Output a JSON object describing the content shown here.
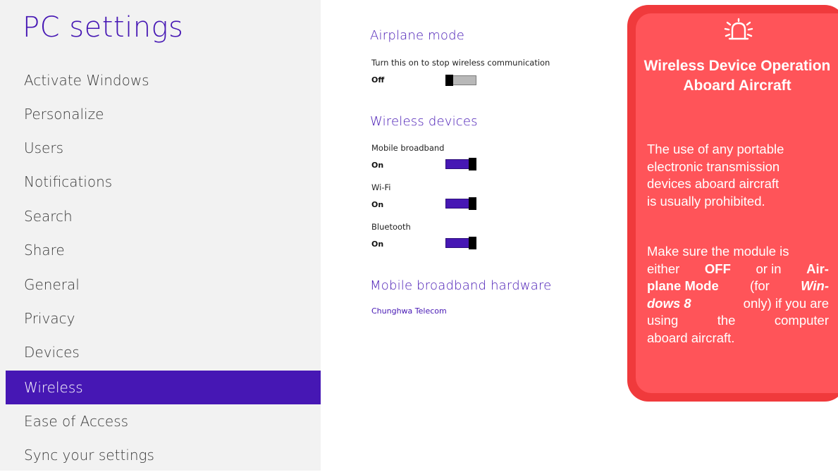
{
  "app": {
    "title": "PC settings"
  },
  "sidebar": {
    "items": [
      {
        "label": "Activate Windows",
        "selected": false
      },
      {
        "label": "Personalize",
        "selected": false
      },
      {
        "label": "Users",
        "selected": false
      },
      {
        "label": "Notifications",
        "selected": false
      },
      {
        "label": "Search",
        "selected": false
      },
      {
        "label": "Share",
        "selected": false
      },
      {
        "label": "General",
        "selected": false
      },
      {
        "label": "Privacy",
        "selected": false
      },
      {
        "label": "Devices",
        "selected": false
      },
      {
        "label": "Wireless",
        "selected": true
      },
      {
        "label": "Ease of Access",
        "selected": false
      },
      {
        "label": "Sync your settings",
        "selected": false
      }
    ]
  },
  "airplane": {
    "heading": "Airplane mode",
    "description": "Turn this on to stop wireless communication",
    "state": "Off"
  },
  "wireless": {
    "heading": "Wireless devices",
    "devices": [
      {
        "label": "Mobile broadband",
        "state": "On"
      },
      {
        "label": "Wi-Fi",
        "state": "On"
      },
      {
        "label": "Bluetooth",
        "state": "On"
      }
    ]
  },
  "hardware": {
    "heading": "Mobile broadband hardware",
    "link": "Chunghwa Telecom"
  },
  "callout": {
    "icon": "warning-bell-icon",
    "title": "Wireless Device Operation Aboard Aircraft",
    "body1": {
      "line1": "The use of any portable",
      "line2": "electronic transmission",
      "line3": "devices aboard aircraft",
      "line4": "is usually prohibited."
    },
    "body2": {
      "w1": "Make sure the module is",
      "w2": "either",
      "w3": "OFF",
      "w4": "or in",
      "w5": "Air-",
      "w6": "plane Mode",
      "w7": "(for",
      "w8": "Win-",
      "w9": "dows 8",
      "w10": "only) if you are",
      "w11": "using the computer",
      "w12": "aboard aircraft."
    },
    "colors": {
      "background": "#ff5459",
      "border": "#f03a3c"
    }
  },
  "colors": {
    "accent": "#4617b4",
    "sidebar_bg": "#f2f2f2"
  }
}
